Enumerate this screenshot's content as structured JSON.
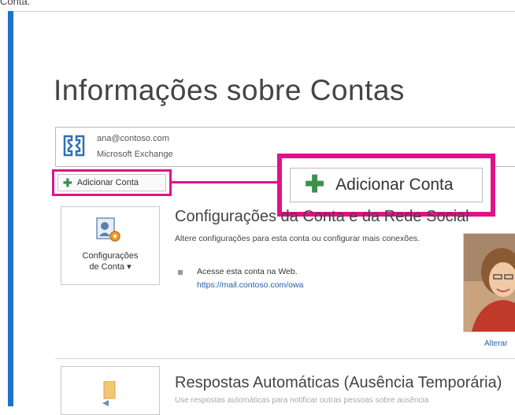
{
  "top_caption": "Conta.",
  "page": {
    "title": "Informações sobre Contas"
  },
  "account": {
    "email": "ana@contoso.com",
    "type": "Microsoft Exchange",
    "icon": "exchange-icon"
  },
  "add_account": {
    "small_label": "Adicionar Conta",
    "big_label": "Adicionar Conta",
    "highlight_color": "#e0128a",
    "plus_color": "#3e8f4a"
  },
  "account_settings": {
    "button_label_line1": "Configurações",
    "button_label_line2": "de Conta ▾",
    "section_title": "Configurações da Conta e da Rede Social",
    "description": "Altere configurações para esta conta ou configurar mais conexões.",
    "bullet_text": "Acesse esta conta na Web.",
    "web_link": "https://mail.contoso.com/owa",
    "change_link": "Alterar"
  },
  "auto_replies": {
    "section_title": "Respostas Automáticas (Ausência Temporária)",
    "description": "Use respostas automáticas para notificar outras pessoas sobre ausência"
  },
  "colors": {
    "accent_blue": "#1e73c8",
    "link": "#1f5fa8"
  }
}
